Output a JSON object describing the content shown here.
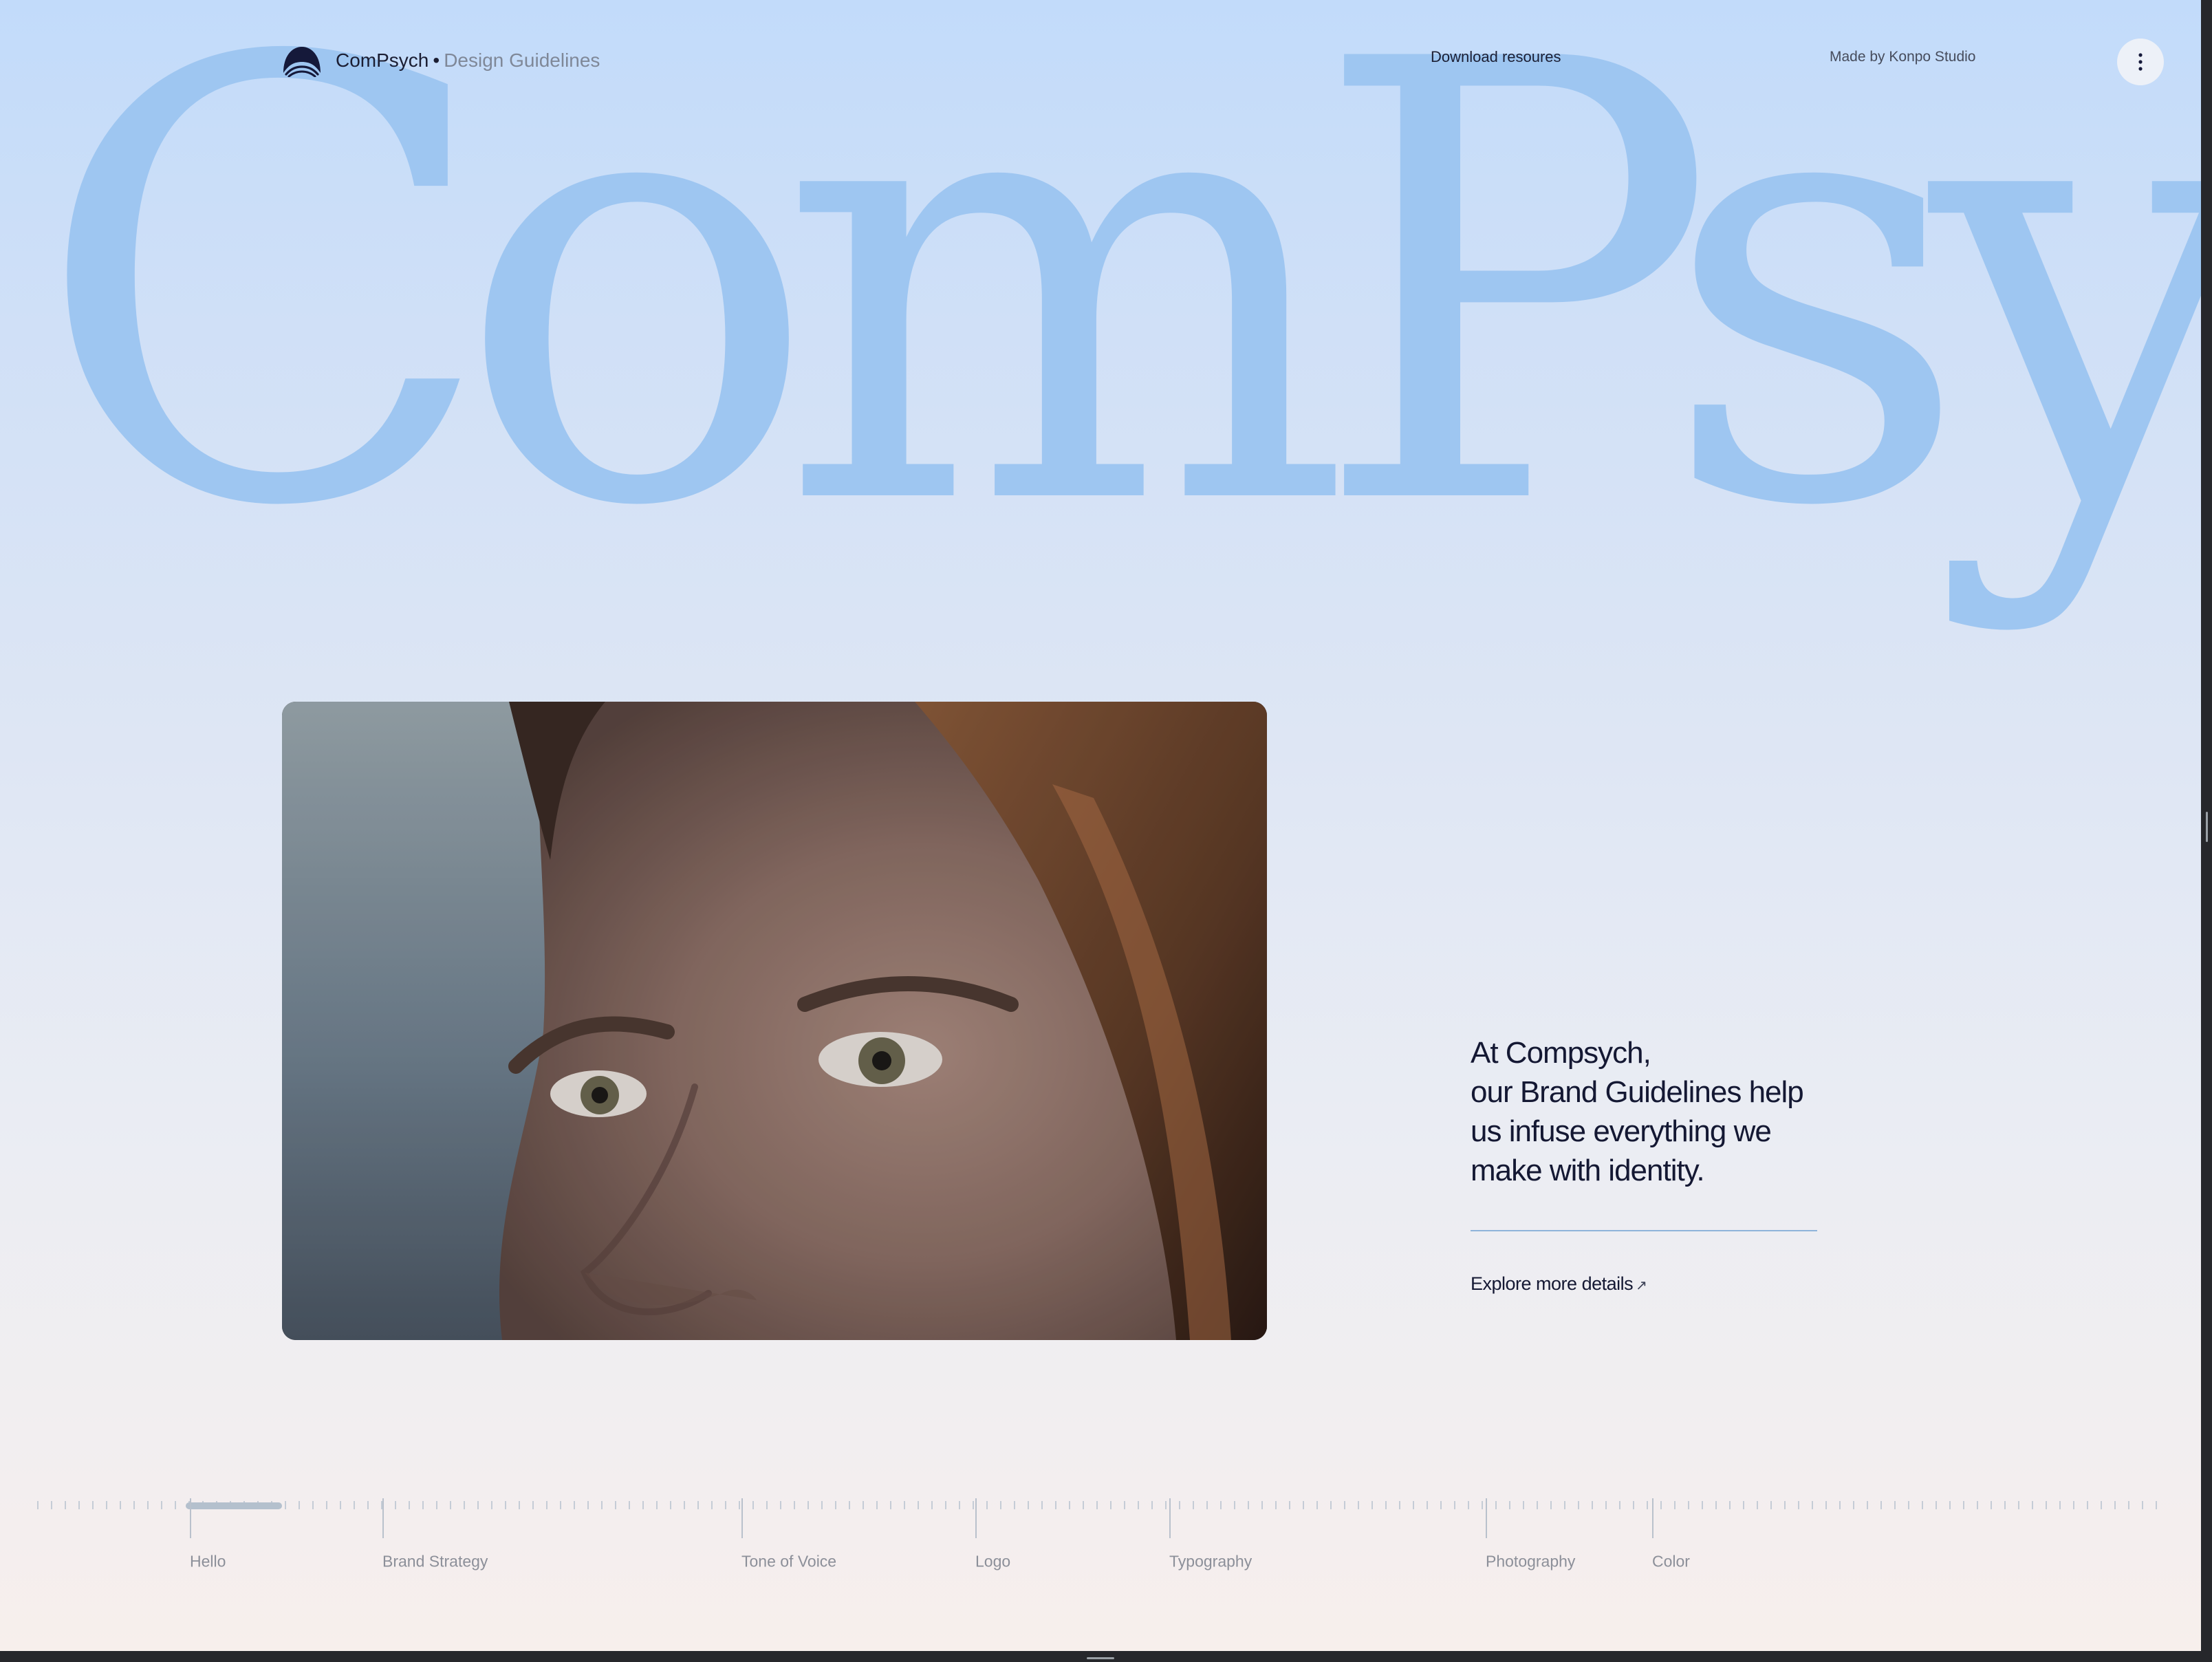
{
  "header": {
    "brand_name": "ComPsych",
    "separator": "•",
    "brand_subtitle": "Design Guidelines",
    "download_label": "Download resoures",
    "credit": "Made by Konpo Studio",
    "menu_icon": "vertical-dots-icon"
  },
  "hero": {
    "wordmark": "ComPsych"
  },
  "intro": {
    "line1": "At Compsych,",
    "line2": "our Brand Guidelines help",
    "line3": "us infuse everything we",
    "line4": "make with identity.",
    "explore_label": "Explore more details",
    "explore_icon": "arrow-up-right-icon"
  },
  "timeline": {
    "progress": 0.05,
    "items": [
      {
        "label": "Hello"
      },
      {
        "label": "Brand Strategy"
      },
      {
        "label": "Tone of Voice"
      },
      {
        "label": "Logo"
      },
      {
        "label": "Typography"
      },
      {
        "label": "Photography"
      },
      {
        "label": "Color"
      }
    ]
  },
  "colors": {
    "wordmark": "#9ec6f1",
    "text_dark": "#141833",
    "accent_line": "#8fb4da"
  }
}
